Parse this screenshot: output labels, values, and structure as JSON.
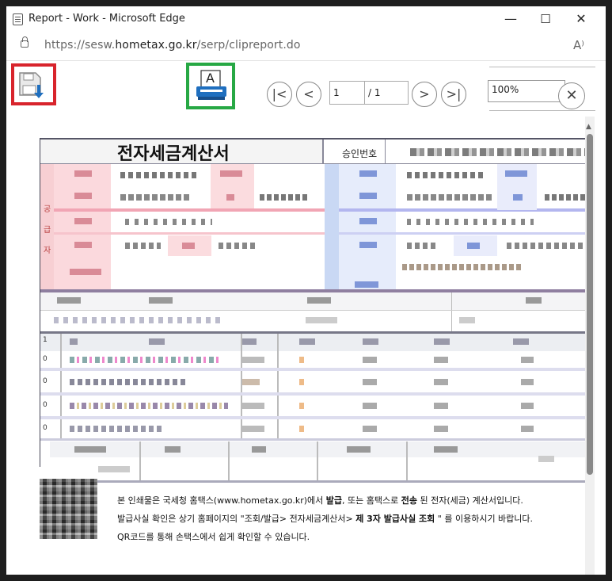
{
  "window": {
    "title": "Report - Work - Microsoft Edge",
    "controls": {
      "minimize": "—",
      "maximize": "☐",
      "close": "✕"
    }
  },
  "address_bar": {
    "url_prefix": "https://sesw.",
    "url_domain": "hometax.go.kr",
    "url_path": "/serp/clipreport.do",
    "read_aloud_icon": "A⁾"
  },
  "toolbar": {
    "first_page": "|<",
    "prev_page": "<",
    "current_page": "1",
    "total_pages": "/ 1",
    "next_page": ">",
    "last_page": ">|",
    "zoom": "100%",
    "close": "✕",
    "print_letter": "A",
    "highlight_colors": {
      "save": "#d8242c",
      "print": "#27a844"
    }
  },
  "document": {
    "title": "전자세금계산서",
    "approval_label": "승인번호",
    "supplier_label": [
      "공",
      "급",
      "자"
    ],
    "row_marks": [
      "1",
      "0",
      "0",
      "0",
      "0"
    ],
    "footer_lines": [
      {
        "pre": "본 인쇄물은 국세청 홈택스(www.hometax.go.kr)에서 ",
        "b1": "발급",
        "mid": ", 또는 홈택스로 ",
        "b2": "전송",
        "post": " 된 전자(세금) 계산서입니다."
      },
      {
        "pre": "발급사실 확인은 상기 홈페이지의 \"조회/발급> 전자세금계산서> ",
        "b1": "제 3자 발급사실 조회",
        "mid": "",
        "b2": "",
        "post": " \" 를 이용하시기 바랍니다."
      },
      {
        "pre": "QR코드를 통해 손택스에서 쉽게 확인할 수 있습니다.",
        "b1": "",
        "mid": "",
        "b2": "",
        "post": ""
      }
    ]
  }
}
